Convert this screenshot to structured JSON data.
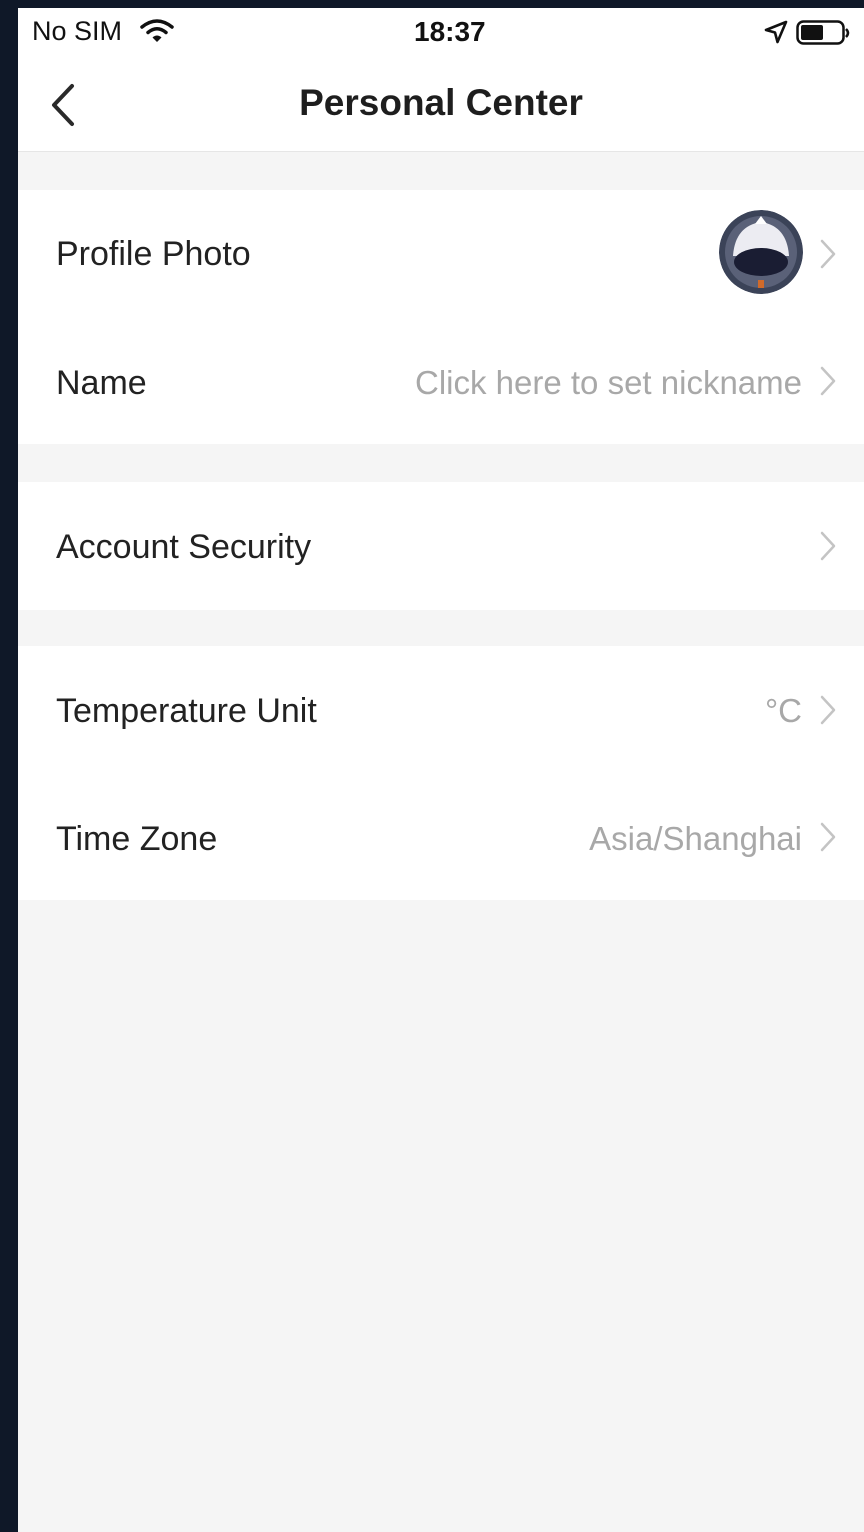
{
  "status_bar": {
    "carrier": "No SIM",
    "time": "18:37",
    "icons": [
      "wifi-icon",
      "location-arrow-icon",
      "battery-icon"
    ]
  },
  "nav": {
    "title": "Personal Center",
    "back_icon": "chevron-left-icon"
  },
  "groups": [
    {
      "rows": [
        {
          "label": "Profile Photo",
          "value": "",
          "has_avatar": true
        },
        {
          "label": "Name",
          "value": "Click here to set nickname"
        }
      ]
    },
    {
      "rows": [
        {
          "label": "Account Security",
          "value": ""
        }
      ]
    },
    {
      "rows": [
        {
          "label": "Temperature Unit",
          "value": "°C"
        },
        {
          "label": "Time Zone",
          "value": "Asia/Shanghai"
        }
      ]
    }
  ],
  "colors": {
    "background": "#f5f5f5",
    "surface": "#ffffff",
    "text_primary": "#222222",
    "text_secondary": "#a8a8a8",
    "frame": "#0f1828"
  }
}
